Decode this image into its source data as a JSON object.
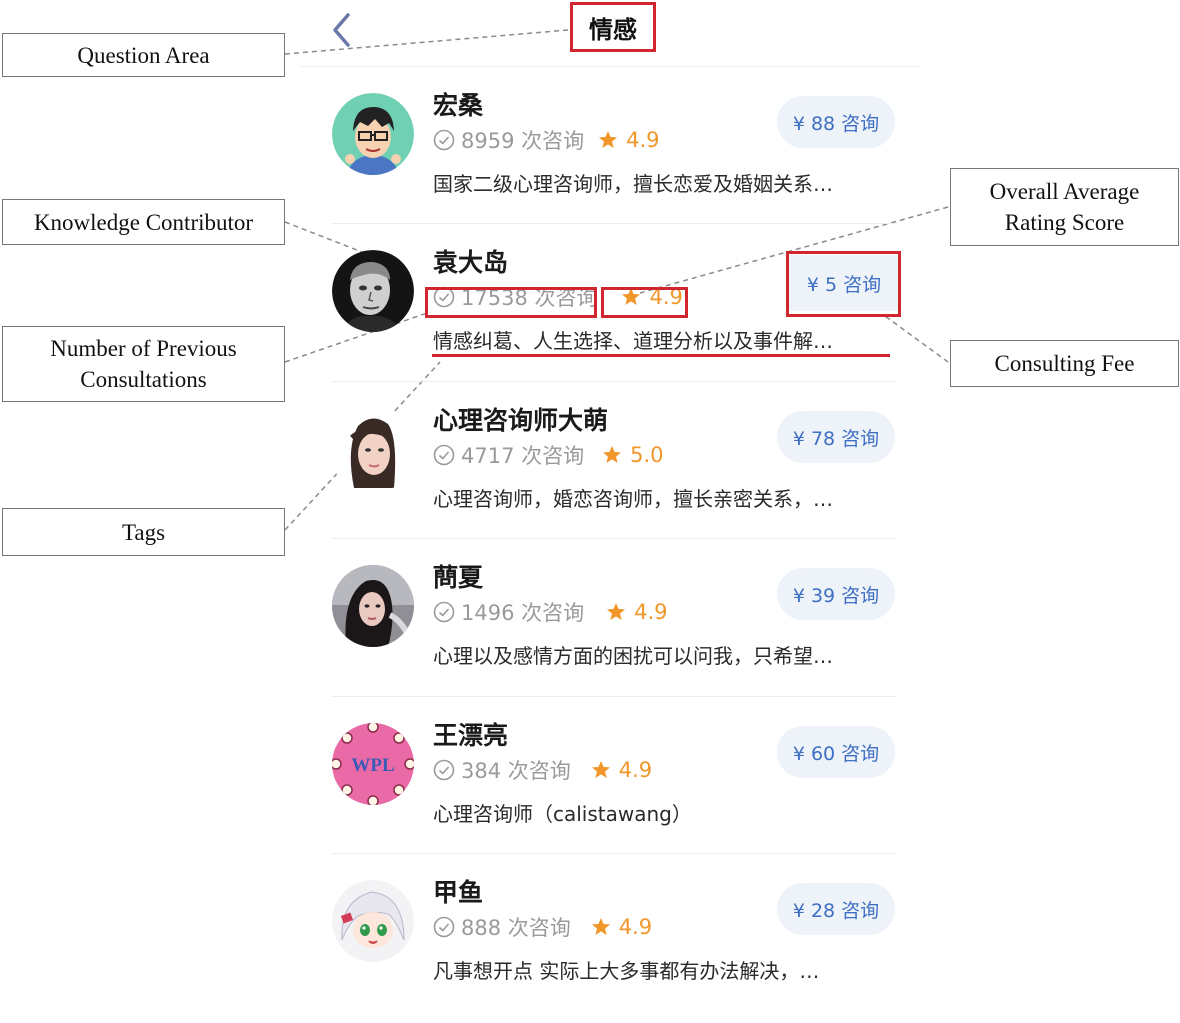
{
  "header": {
    "title": "情感",
    "back_icon": "chevron-left-icon"
  },
  "consultants": [
    {
      "name": "宏桑",
      "count": "8959 次咨询",
      "rating": "4.9",
      "fee": "¥ 88 咨询",
      "tags": "国家二级心理咨询师，擅长恋爱及婚姻关系…",
      "avatar": "cartoon-man-glasses"
    },
    {
      "name": "袁大岛",
      "count": "17538 次咨询",
      "rating": "4.9",
      "fee": "¥ 5 咨询",
      "tags": "情感纠葛、人生选择、道理分析以及事件解…",
      "avatar": "bw-portrait-man"
    },
    {
      "name": "心理咨询师大萌",
      "count": "4717 次咨询",
      "rating": "5.0",
      "fee": "¥ 78 咨询",
      "tags": "心理咨询师，婚恋咨询师，擅长亲密关系，…",
      "avatar": "woman-photo"
    },
    {
      "name": "蔄夏",
      "count": "1496 次咨询",
      "rating": "4.9",
      "fee": "¥ 39 咨询",
      "tags": "心理以及感情方面的困扰可以问我，只希望…",
      "avatar": "woman-photo-dark"
    },
    {
      "name": "王漂亮",
      "count": "384 次咨询",
      "rating": "4.9",
      "fee": "¥ 60 咨询",
      "tags": "心理咨询师（calistawang）",
      "avatar": "wpl-logo",
      "avatar_text": "WPL"
    },
    {
      "name": "甲鱼",
      "count": "888 次咨询",
      "rating": "4.9",
      "fee": "¥ 28 咨询",
      "tags": "凡事想开点 实际上大多事都有办法解决，…",
      "avatar": "anime-girl"
    }
  ],
  "annotations": {
    "question_area": "Question Area",
    "knowledge_contributor": "Knowledge Contributor",
    "number_of_previous_consultations": "Number of Previous Consultations",
    "tags": "Tags",
    "overall_average_rating_score": "Overall Average Rating Score",
    "consulting_fee": "Consulting Fee"
  },
  "colors": {
    "highlight": "#d0262e",
    "rating": "#f0962a",
    "fee_text": "#3f6fc2",
    "fee_bg": "#eef3fa",
    "count": "#9a9a9a"
  }
}
